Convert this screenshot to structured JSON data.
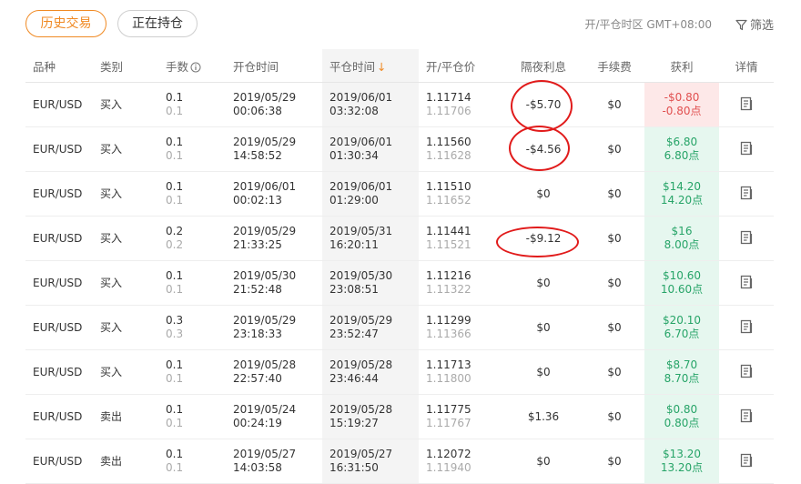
{
  "tabs": {
    "history": "历史交易",
    "positions": "正在持仓"
  },
  "timezone_label": "开/平仓时区 GMT+08:00",
  "filter_label": "筛选",
  "columns": {
    "symbol": "品种",
    "type": "类别",
    "lots": "手数",
    "open_time": "开仓时间",
    "close_time": "平仓时间",
    "price": "开/平仓价",
    "swap": "隔夜利息",
    "fee": "手续费",
    "profit": "获利",
    "detail": "详情"
  },
  "colors": {
    "accent": "#f08a24",
    "profit_positive": "#27a468",
    "profit_positive_bg": "#e6f7ef",
    "profit_negative": "#e15050",
    "profit_negative_bg": "#fde8e8",
    "annotation": "#e11b1b"
  },
  "rows": [
    {
      "symbol": "EUR/USD",
      "type": "买入",
      "lots1": "0.1",
      "lots2": "0.1",
      "open_date": "2019/05/29",
      "open_time": "00:06:38",
      "close_date": "2019/06/01",
      "close_time": "03:32:08",
      "open_price": "1.11714",
      "close_price": "1.11706",
      "swap": "-$5.70",
      "fee": "$0",
      "profit": "-$0.80",
      "points": "-0.80点",
      "positive": false
    },
    {
      "symbol": "EUR/USD",
      "type": "买入",
      "lots1": "0.1",
      "lots2": "0.1",
      "open_date": "2019/05/29",
      "open_time": "14:58:52",
      "close_date": "2019/06/01",
      "close_time": "01:30:34",
      "open_price": "1.11560",
      "close_price": "1.11628",
      "swap": "-$4.56",
      "fee": "$0",
      "profit": "$6.80",
      "points": "6.80点",
      "positive": true
    },
    {
      "symbol": "EUR/USD",
      "type": "买入",
      "lots1": "0.1",
      "lots2": "0.1",
      "open_date": "2019/06/01",
      "open_time": "00:02:13",
      "close_date": "2019/06/01",
      "close_time": "01:29:00",
      "open_price": "1.11510",
      "close_price": "1.11652",
      "swap": "$0",
      "fee": "$0",
      "profit": "$14.20",
      "points": "14.20点",
      "positive": true
    },
    {
      "symbol": "EUR/USD",
      "type": "买入",
      "lots1": "0.2",
      "lots2": "0.2",
      "open_date": "2019/05/29",
      "open_time": "21:33:25",
      "close_date": "2019/05/31",
      "close_time": "16:20:11",
      "open_price": "1.11441",
      "close_price": "1.11521",
      "swap": "-$9.12",
      "fee": "$0",
      "profit": "$16",
      "points": "8.00点",
      "positive": true
    },
    {
      "symbol": "EUR/USD",
      "type": "买入",
      "lots1": "0.1",
      "lots2": "0.1",
      "open_date": "2019/05/30",
      "open_time": "21:52:48",
      "close_date": "2019/05/30",
      "close_time": "23:08:51",
      "open_price": "1.11216",
      "close_price": "1.11322",
      "swap": "$0",
      "fee": "$0",
      "profit": "$10.60",
      "points": "10.60点",
      "positive": true
    },
    {
      "symbol": "EUR/USD",
      "type": "买入",
      "lots1": "0.3",
      "lots2": "0.3",
      "open_date": "2019/05/29",
      "open_time": "23:18:33",
      "close_date": "2019/05/29",
      "close_time": "23:52:47",
      "open_price": "1.11299",
      "close_price": "1.11366",
      "swap": "$0",
      "fee": "$0",
      "profit": "$20.10",
      "points": "6.70点",
      "positive": true
    },
    {
      "symbol": "EUR/USD",
      "type": "买入",
      "lots1": "0.1",
      "lots2": "0.1",
      "open_date": "2019/05/28",
      "open_time": "22:57:40",
      "close_date": "2019/05/28",
      "close_time": "23:46:44",
      "open_price": "1.11713",
      "close_price": "1.11800",
      "swap": "$0",
      "fee": "$0",
      "profit": "$8.70",
      "points": "8.70点",
      "positive": true
    },
    {
      "symbol": "EUR/USD",
      "type": "卖出",
      "lots1": "0.1",
      "lots2": "0.1",
      "open_date": "2019/05/24",
      "open_time": "00:24:19",
      "close_date": "2019/05/28",
      "close_time": "15:19:27",
      "open_price": "1.11775",
      "close_price": "1.11767",
      "swap": "$1.36",
      "fee": "$0",
      "profit": "$0.80",
      "points": "0.80点",
      "positive": true
    },
    {
      "symbol": "EUR/USD",
      "type": "卖出",
      "lots1": "0.1",
      "lots2": "0.1",
      "open_date": "2019/05/27",
      "open_time": "14:03:58",
      "close_date": "2019/05/27",
      "close_time": "16:31:50",
      "open_price": "1.12072",
      "close_price": "1.11940",
      "swap": "$0",
      "fee": "$0",
      "profit": "$13.20",
      "points": "13.20点",
      "positive": true
    }
  ]
}
